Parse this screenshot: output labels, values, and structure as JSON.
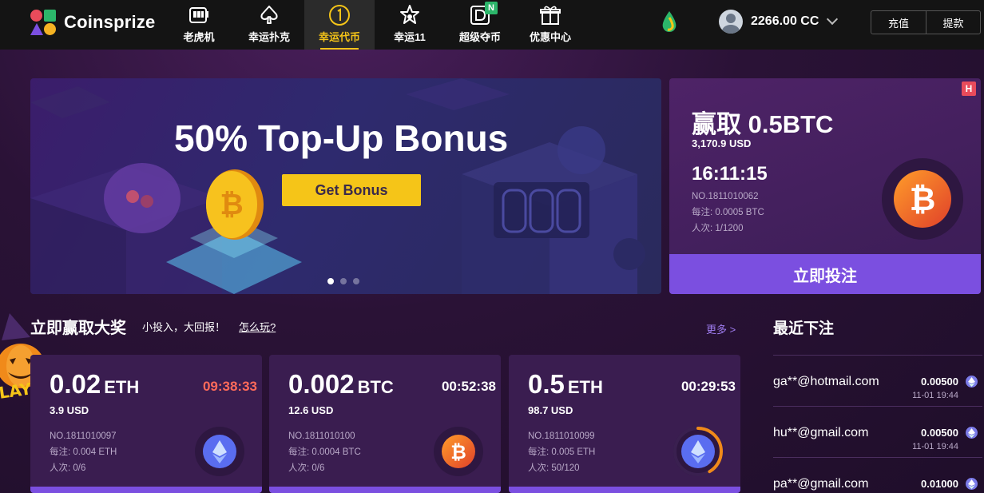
{
  "header": {
    "logo_text": "Coinsprize",
    "nav": [
      {
        "label": "老虎机",
        "icon": "slot-machine-icon"
      },
      {
        "label": "幸运扑克",
        "icon": "spade-icon"
      },
      {
        "label": "幸运代币",
        "icon": "coin-one-icon",
        "active": true
      },
      {
        "label": "幸运11",
        "icon": "star-lotto-icon"
      },
      {
        "label": "超级夺币",
        "icon": "d-coin-icon",
        "badge": "N"
      },
      {
        "label": "优惠中心",
        "icon": "gift-icon"
      }
    ],
    "balance": "2266.00 CC",
    "recharge_label": "充值",
    "withdraw_label": "提款"
  },
  "banner": {
    "title": "50% Top-Up Bonus",
    "button_label": "Get Bonus",
    "slides": 3,
    "active_slide": 0
  },
  "featured": {
    "badge": "H",
    "title": "赢取 0.5BTC",
    "usd": "3,170.9  USD",
    "countdown": "16:11:15",
    "number": "NO.1811010062",
    "stake": "每注: 0.0005 BTC",
    "participants": "人次: 1/1200",
    "button_label": "立即投注",
    "coin": "BTC"
  },
  "section": {
    "title": "立即赢取大奖",
    "subtitle": "小投入，大回报！",
    "how_link": "怎么玩?",
    "more_link": "更多 >"
  },
  "cards": [
    {
      "amount": "0.02",
      "currency": "ETH",
      "countdown": "09:38:33",
      "urgent": true,
      "usd": "3.9  USD",
      "number": "NO.1811010097",
      "stake": "每注: 0.004 ETH",
      "participants": "人次: 0/6",
      "coin": "ETH",
      "progress": 0
    },
    {
      "amount": "0.002",
      "currency": "BTC",
      "countdown": "00:52:38",
      "urgent": false,
      "usd": "12.6  USD",
      "number": "NO.1811010100",
      "stake": "每注: 0.0004 BTC",
      "participants": "人次: 0/6",
      "coin": "BTC",
      "progress": 0
    },
    {
      "amount": "0.5",
      "currency": "ETH",
      "countdown": "00:29:53",
      "urgent": false,
      "usd": "98.7  USD",
      "number": "NO.1811010099",
      "stake": "每注: 0.005 ETH",
      "participants": "人次: 50/120",
      "coin": "ETH",
      "progress": 0.4167
    }
  ],
  "recent": {
    "title": "最近下注",
    "rows": [
      {
        "email": "ga**@hotmail.com",
        "amount": "0.00500",
        "time": "11-01 19:44"
      },
      {
        "email": "hu**@gmail.com",
        "amount": "0.00500",
        "time": "11-01 19:44"
      },
      {
        "email": "pa**@gmail.com",
        "amount": "0.01000",
        "time": ""
      }
    ]
  },
  "colors": {
    "accent": "#7b4fe0",
    "gold": "#f5c518",
    "urgent": "#ff6a5a"
  }
}
